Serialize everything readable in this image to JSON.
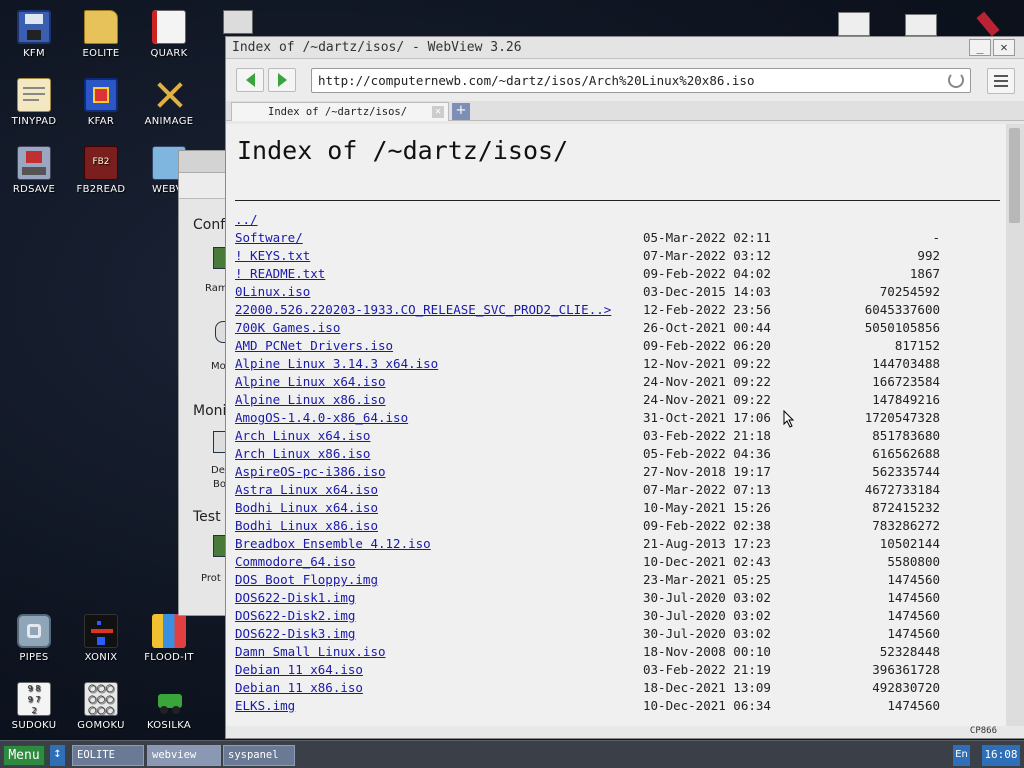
{
  "desktop": {
    "icons": [
      {
        "label": "KFM",
        "icon": "floppy-icon"
      },
      {
        "label": "EOLITE",
        "icon": "folder-icon"
      },
      {
        "label": "QUARK",
        "icon": "book-icon"
      },
      {
        "label": "TINYPAD",
        "icon": "notepad-icon"
      },
      {
        "label": "KFAR",
        "icon": "archive-icon"
      },
      {
        "label": "ANIMAGE",
        "icon": "paint-icon"
      },
      {
        "label": "RDSAVE",
        "icon": "save-icon"
      },
      {
        "label": "FB2READ",
        "icon": "ebook-icon"
      },
      {
        "label": "WEBVI",
        "icon": "webview-icon"
      },
      {
        "label": "PIPES",
        "icon": "pipes-icon"
      },
      {
        "label": "XONIX",
        "icon": "xonix-icon"
      },
      {
        "label": "FLOOD-IT",
        "icon": "flood-icon"
      },
      {
        "label": "SUDOKU",
        "icon": "sudoku-icon"
      },
      {
        "label": "GOMOKU",
        "icon": "gomoku-icon"
      },
      {
        "label": "KOSILKA",
        "icon": "mower-icon"
      }
    ]
  },
  "syspanel": {
    "sections": [
      "Confi",
      "Moni",
      "Test"
    ],
    "items": [
      "Ram",
      "Mo",
      "De",
      "Bo",
      "Prot"
    ]
  },
  "browser": {
    "window_title": "Index of /~dartz/isos/ - WebView 3.26",
    "url": "http://computernewb.com/~dartz/isos/Arch%20Linux%20x86.iso",
    "tab_title": "Index of /~dartz/isos/",
    "page_heading": "Index of /~dartz/isos/",
    "encoding": "CP866",
    "parent_link": "../",
    "listing": [
      {
        "name": "Software/",
        "date": "05-Mar-2022 02:11",
        "size": "-"
      },
      {
        "name": "! KEYS.txt",
        "date": "07-Mar-2022 03:12",
        "size": "992"
      },
      {
        "name": "! README.txt",
        "date": "09-Feb-2022 04:02",
        "size": "1867"
      },
      {
        "name": "0Linux.iso",
        "date": "03-Dec-2015 14:03",
        "size": "70254592"
      },
      {
        "name": "22000.526.220203-1933.CO_RELEASE_SVC_PROD2_CLIE..>",
        "date": "12-Feb-2022 23:56",
        "size": "6045337600"
      },
      {
        "name": "700K Games.iso",
        "date": "26-Oct-2021 00:44",
        "size": "5050105856"
      },
      {
        "name": "AMD PCNet Drivers.iso",
        "date": "09-Feb-2022 06:20",
        "size": "817152"
      },
      {
        "name": "Alpine Linux 3.14.3 x64.iso",
        "date": "12-Nov-2021 09:22",
        "size": "144703488"
      },
      {
        "name": "Alpine Linux x64.iso",
        "date": "24-Nov-2021 09:22",
        "size": "166723584"
      },
      {
        "name": "Alpine Linux x86.iso",
        "date": "24-Nov-2021 09:22",
        "size": "147849216"
      },
      {
        "name": "AmogOS-1.4.0-x86_64.iso",
        "date": "31-Oct-2021 17:06",
        "size": "1720547328"
      },
      {
        "name": "Arch Linux x64.iso",
        "date": "03-Feb-2022 21:18",
        "size": "851783680"
      },
      {
        "name": "Arch Linux x86.iso",
        "date": "05-Feb-2022 04:36",
        "size": "616562688"
      },
      {
        "name": "AspireOS-pc-i386.iso",
        "date": "27-Nov-2018 19:17",
        "size": "562335744"
      },
      {
        "name": "Astra Linux x64.iso",
        "date": "07-Mar-2022 07:13",
        "size": "4672733184"
      },
      {
        "name": "Bodhi Linux x64.iso",
        "date": "10-May-2021 15:26",
        "size": "872415232"
      },
      {
        "name": "Bodhi Linux x86.iso",
        "date": "09-Feb-2022 02:38",
        "size": "783286272"
      },
      {
        "name": "Breadbox Ensemble 4.12.iso",
        "date": "21-Aug-2013 17:23",
        "size": "10502144"
      },
      {
        "name": "Commodore_64.iso",
        "date": "10-Dec-2021 02:43",
        "size": "5580800"
      },
      {
        "name": "DOS Boot Floppy.img",
        "date": "23-Mar-2021 05:25",
        "size": "1474560"
      },
      {
        "name": "DOS622-Disk1.img",
        "date": "30-Jul-2020 03:02",
        "size": "1474560"
      },
      {
        "name": "DOS622-Disk2.img",
        "date": "30-Jul-2020 03:02",
        "size": "1474560"
      },
      {
        "name": "DOS622-Disk3.img",
        "date": "30-Jul-2020 03:02",
        "size": "1474560"
      },
      {
        "name": "Damn Small Linux.iso",
        "date": "18-Nov-2008 00:10",
        "size": "52328448"
      },
      {
        "name": "Debian 11 x64.iso",
        "date": "03-Feb-2022 21:19",
        "size": "396361728"
      },
      {
        "name": "Debian 11 x86.iso",
        "date": "18-Dec-2021 13:09",
        "size": "492830720"
      },
      {
        "name": "ELKS.img",
        "date": "10-Dec-2021 06:34",
        "size": "1474560"
      }
    ]
  },
  "taskbar": {
    "menu_label": "Menu",
    "switch_label": "↕",
    "tasks": [
      "EOLITE",
      "webview",
      "syspanel"
    ],
    "lang": "En",
    "clock": "16:08"
  },
  "colors": {
    "link": "#1a1aaa",
    "start_button": "#2e8a3e",
    "taskbar": "#3a3f48",
    "tray": "#2f6fb8"
  }
}
